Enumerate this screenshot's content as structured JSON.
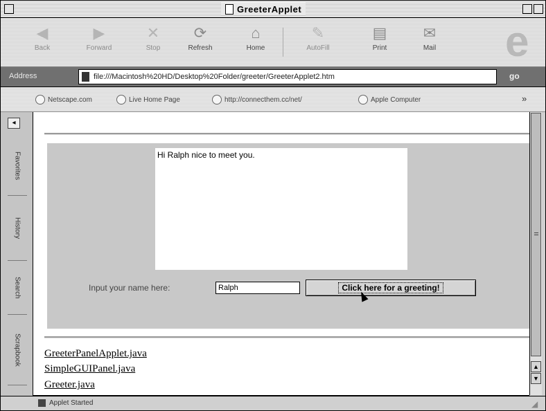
{
  "window": {
    "title": "GreeterApplet"
  },
  "toolbar": {
    "buttons": [
      {
        "label": "Back",
        "icon": "back-arrow-icon",
        "glyph": "◀"
      },
      {
        "label": "Forward",
        "icon": "forward-arrow-icon",
        "glyph": "▶"
      },
      {
        "label": "Stop",
        "icon": "stop-icon",
        "glyph": "✕"
      },
      {
        "label": "Refresh",
        "icon": "refresh-icon",
        "glyph": "⟳"
      },
      {
        "label": "Home",
        "icon": "home-icon",
        "glyph": "⌂"
      },
      {
        "label": "AutoFill",
        "icon": "autofill-icon",
        "glyph": "✎"
      },
      {
        "label": "Print",
        "icon": "printer-icon",
        "glyph": "▤"
      },
      {
        "label": "Mail",
        "icon": "mail-icon",
        "glyph": "✉"
      }
    ],
    "logo": "e"
  },
  "address": {
    "label": "Address",
    "url": "file:///Macintosh%20HD/Desktop%20Folder/greeter/GreeterApplet2.htm",
    "go": "go"
  },
  "favorites": {
    "items": [
      {
        "label": "Netscape.com"
      },
      {
        "label": "Live Home Page"
      },
      {
        "label": "http://connecthem.cc/net/"
      },
      {
        "label": "Apple Computer"
      }
    ],
    "more": "»"
  },
  "sidebar": {
    "tabs": [
      {
        "label": "Favorites"
      },
      {
        "label": "History"
      },
      {
        "label": "Search"
      },
      {
        "label": "Scrapbook"
      }
    ]
  },
  "applet": {
    "greeting": "Hi Ralph nice to meet you.",
    "prompt": "Input your name here:",
    "name_value": "Ralph",
    "button_label": "Click here for a greeting!"
  },
  "links": [
    "GreeterPanelApplet.java",
    "SimpleGUIPanel.java",
    "Greeter.java"
  ],
  "status": {
    "text": "Applet Started"
  }
}
